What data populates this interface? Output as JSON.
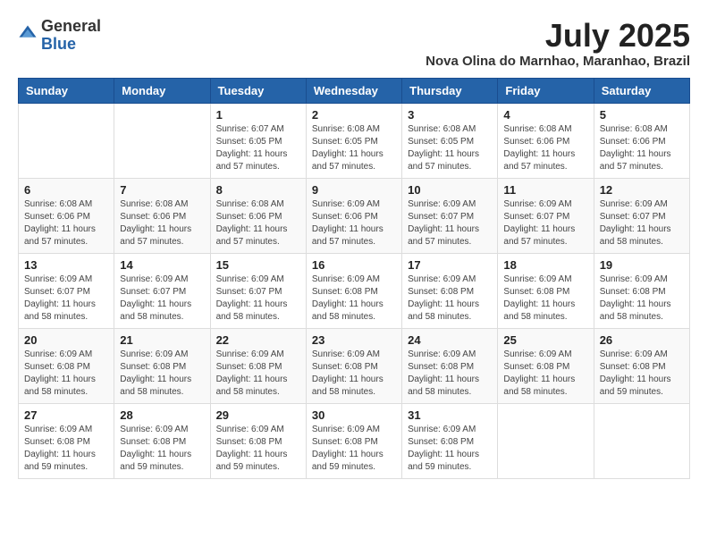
{
  "header": {
    "logo_general": "General",
    "logo_blue": "Blue",
    "title": "July 2025",
    "location": "Nova Olina do Marnhao, Maranhao, Brazil"
  },
  "days_of_week": [
    "Sunday",
    "Monday",
    "Tuesday",
    "Wednesday",
    "Thursday",
    "Friday",
    "Saturday"
  ],
  "weeks": [
    [
      {
        "day": "",
        "info": ""
      },
      {
        "day": "",
        "info": ""
      },
      {
        "day": "1",
        "info": "Sunrise: 6:07 AM\nSunset: 6:05 PM\nDaylight: 11 hours and 57 minutes."
      },
      {
        "day": "2",
        "info": "Sunrise: 6:08 AM\nSunset: 6:05 PM\nDaylight: 11 hours and 57 minutes."
      },
      {
        "day": "3",
        "info": "Sunrise: 6:08 AM\nSunset: 6:05 PM\nDaylight: 11 hours and 57 minutes."
      },
      {
        "day": "4",
        "info": "Sunrise: 6:08 AM\nSunset: 6:06 PM\nDaylight: 11 hours and 57 minutes."
      },
      {
        "day": "5",
        "info": "Sunrise: 6:08 AM\nSunset: 6:06 PM\nDaylight: 11 hours and 57 minutes."
      }
    ],
    [
      {
        "day": "6",
        "info": "Sunrise: 6:08 AM\nSunset: 6:06 PM\nDaylight: 11 hours and 57 minutes."
      },
      {
        "day": "7",
        "info": "Sunrise: 6:08 AM\nSunset: 6:06 PM\nDaylight: 11 hours and 57 minutes."
      },
      {
        "day": "8",
        "info": "Sunrise: 6:08 AM\nSunset: 6:06 PM\nDaylight: 11 hours and 57 minutes."
      },
      {
        "day": "9",
        "info": "Sunrise: 6:09 AM\nSunset: 6:06 PM\nDaylight: 11 hours and 57 minutes."
      },
      {
        "day": "10",
        "info": "Sunrise: 6:09 AM\nSunset: 6:07 PM\nDaylight: 11 hours and 57 minutes."
      },
      {
        "day": "11",
        "info": "Sunrise: 6:09 AM\nSunset: 6:07 PM\nDaylight: 11 hours and 57 minutes."
      },
      {
        "day": "12",
        "info": "Sunrise: 6:09 AM\nSunset: 6:07 PM\nDaylight: 11 hours and 58 minutes."
      }
    ],
    [
      {
        "day": "13",
        "info": "Sunrise: 6:09 AM\nSunset: 6:07 PM\nDaylight: 11 hours and 58 minutes."
      },
      {
        "day": "14",
        "info": "Sunrise: 6:09 AM\nSunset: 6:07 PM\nDaylight: 11 hours and 58 minutes."
      },
      {
        "day": "15",
        "info": "Sunrise: 6:09 AM\nSunset: 6:07 PM\nDaylight: 11 hours and 58 minutes."
      },
      {
        "day": "16",
        "info": "Sunrise: 6:09 AM\nSunset: 6:08 PM\nDaylight: 11 hours and 58 minutes."
      },
      {
        "day": "17",
        "info": "Sunrise: 6:09 AM\nSunset: 6:08 PM\nDaylight: 11 hours and 58 minutes."
      },
      {
        "day": "18",
        "info": "Sunrise: 6:09 AM\nSunset: 6:08 PM\nDaylight: 11 hours and 58 minutes."
      },
      {
        "day": "19",
        "info": "Sunrise: 6:09 AM\nSunset: 6:08 PM\nDaylight: 11 hours and 58 minutes."
      }
    ],
    [
      {
        "day": "20",
        "info": "Sunrise: 6:09 AM\nSunset: 6:08 PM\nDaylight: 11 hours and 58 minutes."
      },
      {
        "day": "21",
        "info": "Sunrise: 6:09 AM\nSunset: 6:08 PM\nDaylight: 11 hours and 58 minutes."
      },
      {
        "day": "22",
        "info": "Sunrise: 6:09 AM\nSunset: 6:08 PM\nDaylight: 11 hours and 58 minutes."
      },
      {
        "day": "23",
        "info": "Sunrise: 6:09 AM\nSunset: 6:08 PM\nDaylight: 11 hours and 58 minutes."
      },
      {
        "day": "24",
        "info": "Sunrise: 6:09 AM\nSunset: 6:08 PM\nDaylight: 11 hours and 58 minutes."
      },
      {
        "day": "25",
        "info": "Sunrise: 6:09 AM\nSunset: 6:08 PM\nDaylight: 11 hours and 58 minutes."
      },
      {
        "day": "26",
        "info": "Sunrise: 6:09 AM\nSunset: 6:08 PM\nDaylight: 11 hours and 59 minutes."
      }
    ],
    [
      {
        "day": "27",
        "info": "Sunrise: 6:09 AM\nSunset: 6:08 PM\nDaylight: 11 hours and 59 minutes."
      },
      {
        "day": "28",
        "info": "Sunrise: 6:09 AM\nSunset: 6:08 PM\nDaylight: 11 hours and 59 minutes."
      },
      {
        "day": "29",
        "info": "Sunrise: 6:09 AM\nSunset: 6:08 PM\nDaylight: 11 hours and 59 minutes."
      },
      {
        "day": "30",
        "info": "Sunrise: 6:09 AM\nSunset: 6:08 PM\nDaylight: 11 hours and 59 minutes."
      },
      {
        "day": "31",
        "info": "Sunrise: 6:09 AM\nSunset: 6:08 PM\nDaylight: 11 hours and 59 minutes."
      },
      {
        "day": "",
        "info": ""
      },
      {
        "day": "",
        "info": ""
      }
    ]
  ]
}
